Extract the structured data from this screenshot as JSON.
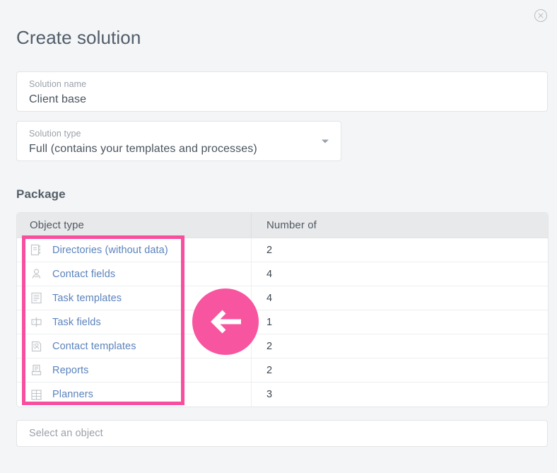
{
  "dialog": {
    "title": "Create solution",
    "close_icon": "close-circle-icon"
  },
  "form": {
    "solution_name": {
      "label": "Solution name",
      "value": "Client base"
    },
    "solution_type": {
      "label": "Solution type",
      "value": "Full (contains your templates and processes)",
      "caret_icon": "chevron-down-icon"
    }
  },
  "package": {
    "heading": "Package",
    "columns": [
      "Object type",
      "Number of"
    ],
    "rows": [
      {
        "icon": "directory-icon",
        "label": "Directories (without data)",
        "count": "2"
      },
      {
        "icon": "contact-field-icon",
        "label": "Contact fields",
        "count": "4"
      },
      {
        "icon": "task-template-icon",
        "label": "Task templates",
        "count": "4"
      },
      {
        "icon": "task-field-icon",
        "label": "Task fields",
        "count": "1"
      },
      {
        "icon": "contact-template-icon",
        "label": "Contact templates",
        "count": "2"
      },
      {
        "icon": "report-icon",
        "label": "Reports",
        "count": "2"
      },
      {
        "icon": "planner-icon",
        "label": "Planners",
        "count": "3"
      }
    ]
  },
  "select_object": {
    "placeholder": "Select an object"
  },
  "annotation": {
    "highlight_color": "#f74f9e",
    "arrow_icon": "arrow-left-icon",
    "arrow_color": "#f7559f"
  }
}
